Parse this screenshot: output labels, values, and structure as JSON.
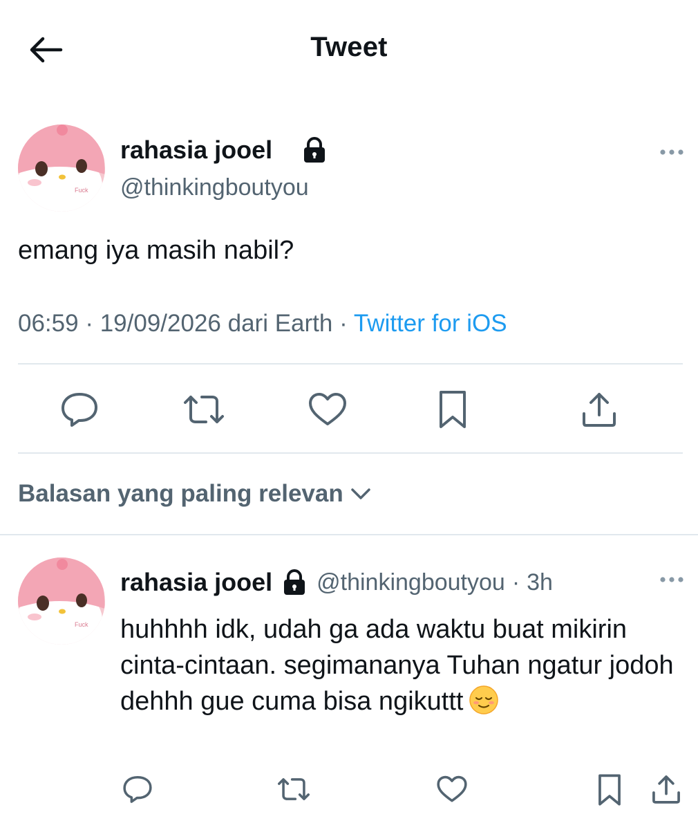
{
  "header": {
    "title": "Tweet",
    "back_icon": "arrow-left-icon"
  },
  "tweet": {
    "author_name": "rahasia jooel",
    "author_handle": "@thinkingboutyou",
    "protected_icon": "lock-icon",
    "avatar_text": "Fuck",
    "text": "emang iya masih nabil?",
    "time": "06:59",
    "date": "19/09/2026",
    "location": "dari Earth",
    "separator": "·",
    "source": "Twitter for iOS",
    "actions": [
      "reply-icon",
      "retweet-icon",
      "like-icon",
      "bookmark-icon",
      "share-icon"
    ]
  },
  "replies_sort": {
    "label": "Balasan yang paling relevan",
    "icon": "chevron-down-icon"
  },
  "reply": {
    "author_name": "rahasia jooel",
    "author_handle": "@thinkingboutyou",
    "dot": "·",
    "time": "3h",
    "avatar_text": "Fuck",
    "text": "huhhhh idk, udah ga ada waktu buat mikirin cinta-cintaan. segimananya Tuhan ngatur jodoh dehhh gue cuma bisa ngikuttt",
    "emoji": "relieved-face-emoji"
  },
  "colors": {
    "text": "#0f1419",
    "secondary": "#536471",
    "link": "#1d9bf0",
    "divider": "#e1e8ed"
  }
}
